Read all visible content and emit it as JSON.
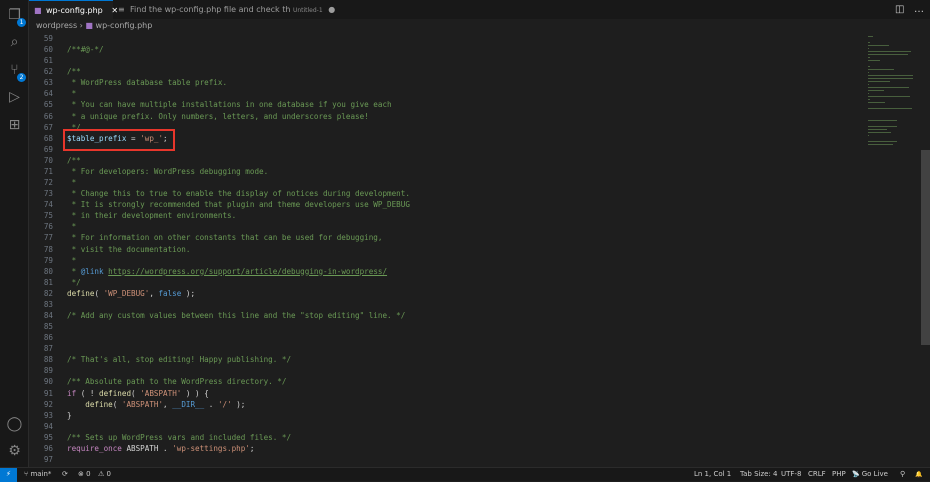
{
  "activity": {
    "explorer_badge": "1",
    "scm_badge": "2"
  },
  "tabs": [
    {
      "label": "wp-config.php",
      "close": "✕"
    },
    {
      "label": "Find the wp-config.php file and check th",
      "sub": "Untitled-1",
      "dot": "●"
    }
  ],
  "breadcrumb": {
    "folder": "wordpress",
    "sep": "›",
    "file": "wp-config.php"
  },
  "top_icons": {
    "split": "◫",
    "more": "…"
  },
  "highlight_color": "#e8362b",
  "code": [
    {
      "n": "59",
      "t": []
    },
    {
      "n": "60",
      "t": [
        [
          "c",
          "/**#@-*/"
        ]
      ]
    },
    {
      "n": "61",
      "t": []
    },
    {
      "n": "62",
      "t": [
        [
          "c",
          "/**"
        ]
      ]
    },
    {
      "n": "63",
      "t": [
        [
          "c",
          " * WordPress database table prefix."
        ]
      ]
    },
    {
      "n": "64",
      "t": [
        [
          "c",
          " *"
        ]
      ]
    },
    {
      "n": "65",
      "t": [
        [
          "c",
          " * You can have multiple installations in one database if you give each"
        ]
      ]
    },
    {
      "n": "66",
      "t": [
        [
          "c",
          " * a unique prefix. Only numbers, letters, and underscores please!"
        ]
      ]
    },
    {
      "n": "67",
      "t": [
        [
          "c",
          " */"
        ]
      ]
    },
    {
      "n": "68",
      "t": [
        [
          "v",
          "$table_prefix"
        ],
        [
          "",
          "="
        ],
        [
          "s",
          "'wp_'"
        ],
        [
          "",
          ";"
        ]
      ]
    },
    {
      "n": "69",
      "t": []
    },
    {
      "n": "70",
      "t": [
        [
          "c",
          "/**"
        ]
      ]
    },
    {
      "n": "71",
      "t": [
        [
          "c",
          " * For developers: WordPress debugging mode."
        ]
      ]
    },
    {
      "n": "72",
      "t": [
        [
          "c",
          " *"
        ]
      ]
    },
    {
      "n": "73",
      "t": [
        [
          "c",
          " * Change this to true to enable the display of notices during development."
        ]
      ]
    },
    {
      "n": "74",
      "t": [
        [
          "c",
          " * It is strongly recommended that plugin and theme developers use WP_DEBUG"
        ]
      ]
    },
    {
      "n": "75",
      "t": [
        [
          "c",
          " * in their development environments."
        ]
      ]
    },
    {
      "n": "76",
      "t": [
        [
          "c",
          " *"
        ]
      ]
    },
    {
      "n": "77",
      "t": [
        [
          "c",
          " * For information on other constants that can be used for debugging,"
        ]
      ]
    },
    {
      "n": "78",
      "t": [
        [
          "c",
          " * visit the documentation."
        ]
      ]
    },
    {
      "n": "79",
      "t": [
        [
          "c",
          " *"
        ]
      ]
    },
    {
      "n": "80",
      "t": [
        [
          "c",
          " * "
        ],
        [
          "ct",
          "@link"
        ],
        [
          "c",
          " "
        ],
        [
          "u",
          "https://wordpress.org/support/article/debugging-in-wordpress/"
        ]
      ]
    },
    {
      "n": "81",
      "t": [
        [
          "c",
          " */"
        ]
      ]
    },
    {
      "n": "82",
      "t": [
        [
          "f",
          "define"
        ],
        [
          "",
          "( "
        ],
        [
          "s",
          "'WP_DEBUG'"
        ],
        [
          "",
          ", "
        ],
        [
          "k",
          "false"
        ],
        [
          "",
          " );"
        ]
      ]
    },
    {
      "n": "83",
      "t": []
    },
    {
      "n": "84",
      "t": [
        [
          "c",
          "/* Add any custom values between this line and the \"stop editing\" line. */"
        ]
      ]
    },
    {
      "n": "85",
      "t": []
    },
    {
      "n": "86",
      "t": []
    },
    {
      "n": "87",
      "t": []
    },
    {
      "n": "88",
      "t": [
        [
          "c",
          "/* That's all, stop editing! Happy publishing. */"
        ]
      ]
    },
    {
      "n": "89",
      "t": []
    },
    {
      "n": "90",
      "t": [
        [
          "c",
          "/** Absolute path to the WordPress directory. */"
        ]
      ]
    },
    {
      "n": "91",
      "t": [
        [
          "kw",
          "if"
        ],
        [
          "",
          " ( ! "
        ],
        [
          "f",
          "defined"
        ],
        [
          "",
          "( "
        ],
        [
          "s",
          "'ABSPATH'"
        ],
        [
          "",
          " ) ) {"
        ]
      ]
    },
    {
      "n": "92",
      "t": [
        [
          "",
          "    "
        ],
        [
          "f",
          "define"
        ],
        [
          "",
          "( "
        ],
        [
          "s",
          "'ABSPATH'"
        ],
        [
          "",
          ", "
        ],
        [
          "k",
          "__DIR__"
        ],
        [
          "",
          " . "
        ],
        [
          "s",
          "'/'"
        ],
        [
          "",
          " );"
        ]
      ]
    },
    {
      "n": "93",
      "t": [
        [
          "",
          "}"
        ]
      ]
    },
    {
      "n": "94",
      "t": []
    },
    {
      "n": "95",
      "t": [
        [
          "c",
          "/** Sets up WordPress vars and included files. */"
        ]
      ]
    },
    {
      "n": "96",
      "t": [
        [
          "kw",
          "require_once"
        ],
        [
          "",
          " ABSPATH . "
        ],
        [
          "s",
          "'wp-settings.php'"
        ],
        [
          "",
          ";"
        ]
      ]
    },
    {
      "n": "97",
      "t": []
    }
  ],
  "status": {
    "remote": "⚡",
    "branch": "main*",
    "sync": "⟳",
    "errors": "⊗ 0",
    "warnings": "⚠ 0",
    "position": "Ln 1, Col 1",
    "tab_size": "Tab Size: 4",
    "encoding": "UTF-8",
    "eol": "CRLF",
    "language": "PHP",
    "go_live": "Go Live",
    "go_live_icon": "📡",
    "feedback": "⚲",
    "bell": "🔔"
  }
}
